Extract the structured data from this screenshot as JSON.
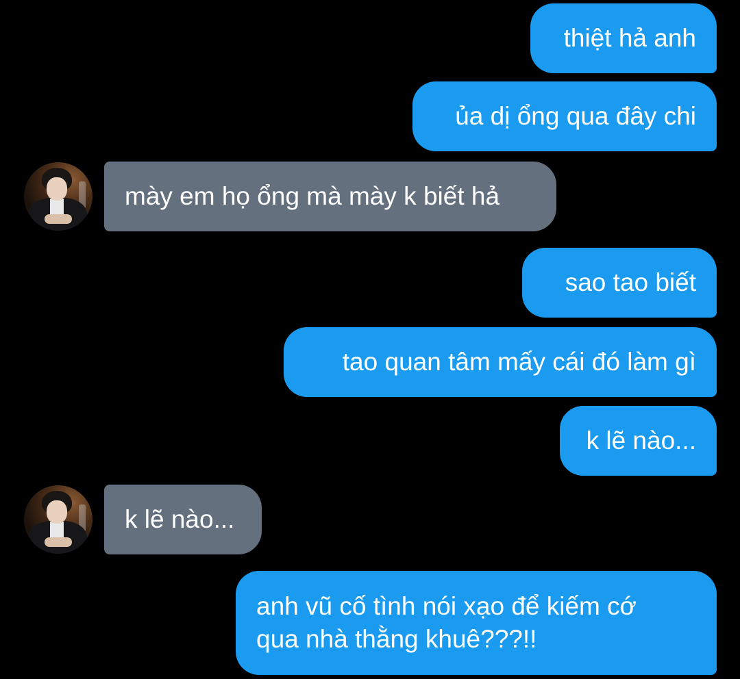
{
  "messages": [
    {
      "from": "me",
      "text": "thiệt hả anh"
    },
    {
      "from": "me",
      "text": "ủa dị ổng qua đây chi"
    },
    {
      "from": "them",
      "text": "mày em họ ổng mà mày k biết hả"
    },
    {
      "from": "me",
      "text": "sao tao biết"
    },
    {
      "from": "me",
      "text": "tao quan tâm mấy cái đó làm gì"
    },
    {
      "from": "me",
      "text": "k lẽ nào..."
    },
    {
      "from": "them",
      "text": "k lẽ nào..."
    },
    {
      "from": "me",
      "lines": [
        "anh vũ cố tình nói xạo để kiếm cớ",
        "qua nhà thằng khuê???!!"
      ]
    }
  ],
  "colors": {
    "background": "#000000",
    "outgoing_bubble": "#1b9bef",
    "incoming_bubble": "#64707d",
    "text": "#ffffff"
  },
  "icons": {
    "avatar": "contact-avatar-photo"
  }
}
